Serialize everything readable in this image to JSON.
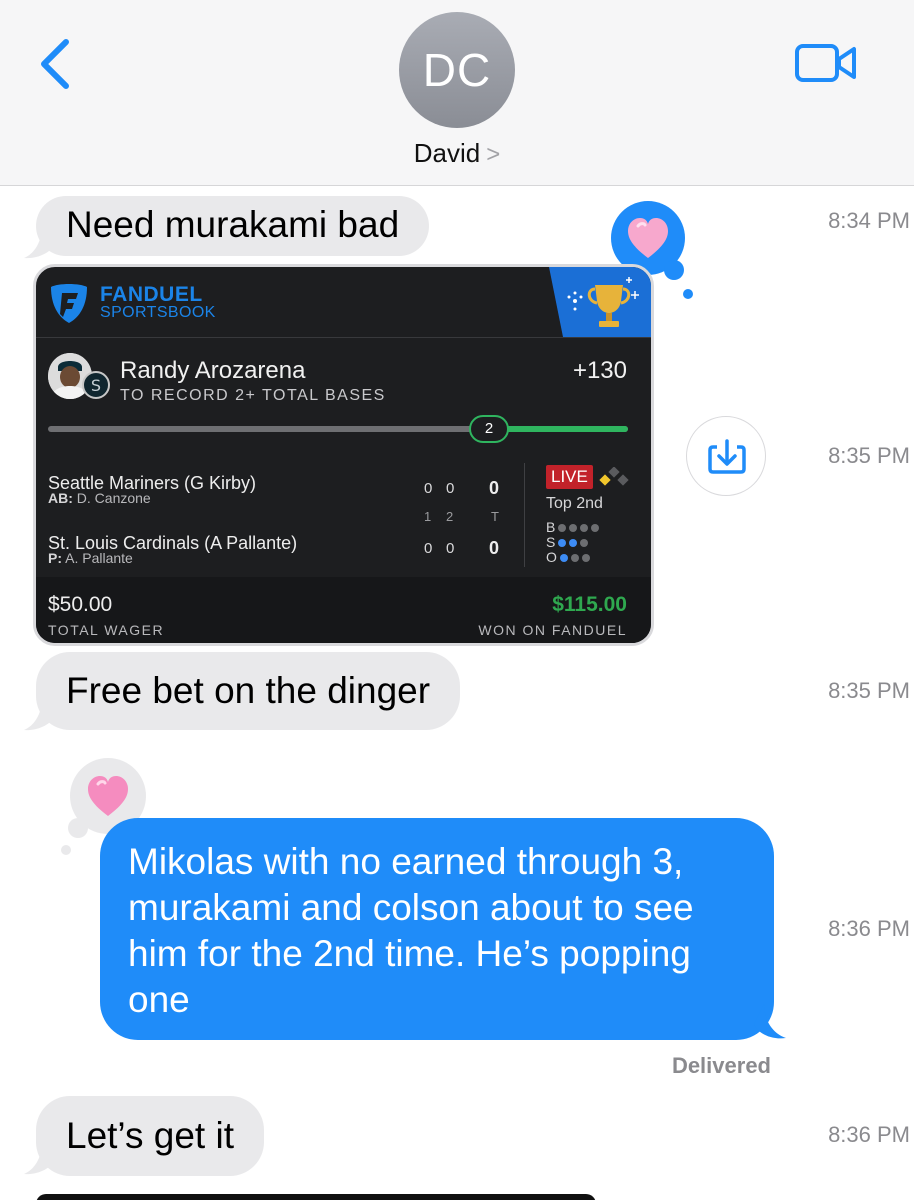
{
  "header": {
    "avatar_initials": "DC",
    "contact_name": "David",
    "contact_chevron": ">",
    "back_icon": "chevron-left-icon",
    "video_icon": "video-camera-icon",
    "accent_color": "#1f8cf9"
  },
  "messages": [
    {
      "type": "received",
      "text": "Need murakami bad",
      "time": "8:34 PM",
      "reaction": "heart"
    },
    {
      "type": "received-card",
      "time": "8:35 PM"
    },
    {
      "type": "received",
      "text": "Free bet on the dinger",
      "time": "8:35 PM"
    },
    {
      "type": "sent",
      "text": "Mikolas with no earned through 3, murakami and colson about to see him for the 2nd time. He’s popping one",
      "time": "8:36 PM",
      "reaction": "heart",
      "status": "Delivered"
    },
    {
      "type": "received",
      "text": "Let’s get it",
      "time": "8:36 PM"
    }
  ],
  "card": {
    "brand": "FANDUEL",
    "brand_sub": "SPORTSBOOK",
    "player": "Randy Arozarena",
    "prop": "TO RECORD 2+ TOTAL BASES",
    "odds": "+130",
    "progress_value": "2",
    "progress_fraction": 0.76,
    "home_team": "Seattle Mariners (G Kirby)",
    "home_sub_label": "AB:",
    "home_sub": "D. Canzone",
    "away_team": "St. Louis Cardinals (A Pallante)",
    "away_sub_label": "P:",
    "away_sub": "A. Pallante",
    "innings_header": [
      "1",
      "2",
      "T"
    ],
    "home_scores": [
      "0",
      "0",
      "0"
    ],
    "away_scores": [
      "0",
      "0",
      "0"
    ],
    "live_label": "LIVE",
    "inning": "Top 2nd",
    "balls_label": "B",
    "strikes_label": "S",
    "outs_label": "O",
    "balls": 0,
    "strikes": 2,
    "outs": 1,
    "wager": "$50.00",
    "wager_label": "TOTAL WAGER",
    "won": "$115.00",
    "won_label": "WON ON FANDUEL"
  },
  "save_icon": "save-download-icon"
}
